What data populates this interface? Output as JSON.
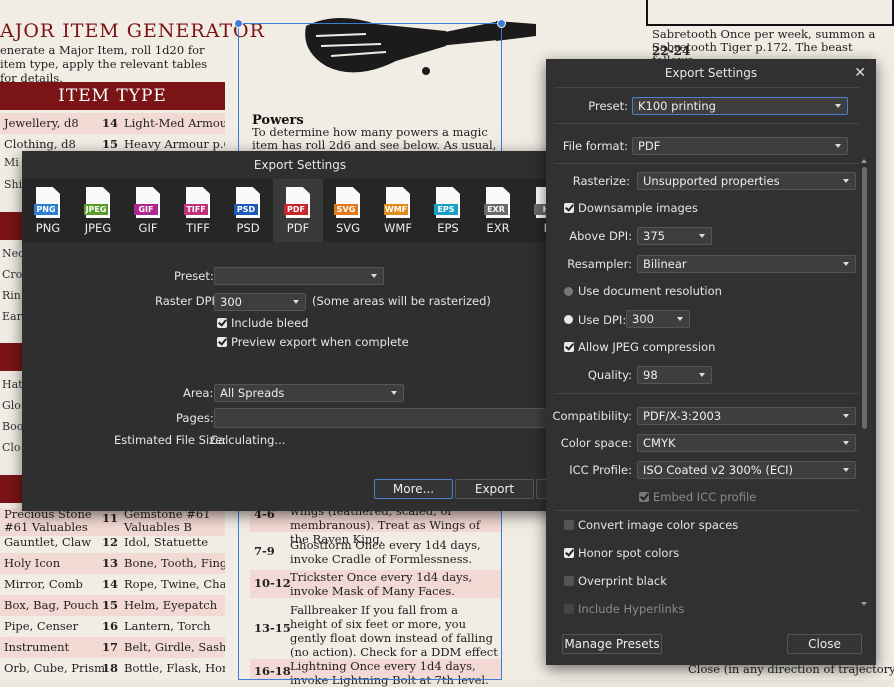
{
  "document": {
    "title": "AJOR ITEM GENERATOR",
    "intro": "enerate a Major Item, roll 1d20 for item type, apply the relevant tables for details.",
    "banner": "ITEM TYPE",
    "item_rows_top": [
      {
        "a": "Jewellery, d8",
        "n": "14",
        "b": "Light-Med Armour p.61"
      },
      {
        "a": "Clothing, d8",
        "n": "15",
        "b": "Heavy Armour p.61"
      }
    ],
    "left_fragments": [
      "Mi",
      "Shi",
      "Nec",
      "Cro",
      "Rin",
      "Ear",
      "Hat",
      "Glo",
      "Boo",
      "Clo"
    ],
    "item_rows_bottom": [
      {
        "a": "Precious Stone #61 Valuables A",
        "n": "11",
        "b": "Gemstone #61 Valuables B"
      },
      {
        "a": "Gauntlet, Claw",
        "n": "12",
        "b": "Idol, Statuette"
      },
      {
        "a": "Holy Icon",
        "n": "13",
        "b": "Bone, Tooth, Finger"
      },
      {
        "a": "Mirror, Comb",
        "n": "14",
        "b": "Rope, Twine, Chain"
      },
      {
        "a": "Box, Bag, Pouch",
        "n": "15",
        "b": "Helm, Eyepatch"
      },
      {
        "a": "Pipe, Censer",
        "n": "16",
        "b": "Lantern, Torch"
      },
      {
        "a": "Instrument",
        "n": "17",
        "b": "Belt, Girdle, Sash"
      },
      {
        "a": "Orb, Cube, Prism",
        "n": "18",
        "b": "Bottle, Flask, Horn"
      }
    ],
    "powers_heading": "Powers",
    "powers_text": "To determine how many powers a magic item has roll 2d6 and see below. As usual, the owner must",
    "powers_rows": [
      {
        "n": "4-6",
        "t": "wings (feathered, scaled, or membranous). Treat as Wings of the Raven King."
      },
      {
        "n": "7-9",
        "t": "Ghostform Once every 1d4 days, invoke Cradle of Formlessness."
      },
      {
        "n": "10-12",
        "t": "Trickster Once every 1d4 days, invoke Mask of Many Faces."
      },
      {
        "n": "13-15",
        "t": "Fallbreaker If you fall from a height of six feet or more, you gently float down instead of falling (no action). Check for a DDM effect each time this activates."
      },
      {
        "n": "16-18",
        "t": "Lightning Once every 1d4 days, invoke Lightning Bolt at 7th level."
      }
    ],
    "right_text": "Sabretooth Once per week, summon a Sabretooth Tiger p.172. The beast follows",
    "right_num": "22-24",
    "right_bottom": "Close (in any direction of trajectory)."
  },
  "export_left": {
    "title": "Export Settings",
    "formats": [
      {
        "name": "PNG",
        "color": "#2f7fd1"
      },
      {
        "name": "JPEG",
        "color": "#5a9a2a"
      },
      {
        "name": "GIF",
        "color": "#b0278f"
      },
      {
        "name": "TIFF",
        "color": "#c0337a"
      },
      {
        "name": "PSD",
        "color": "#1f5bb8"
      },
      {
        "name": "PDF",
        "color": "#c8262a"
      },
      {
        "name": "SVG",
        "color": "#e07a1a"
      },
      {
        "name": "WMF",
        "color": "#e08a1a"
      },
      {
        "name": "EPS",
        "color": "#1aa0c8"
      },
      {
        "name": "EXR",
        "color": "#6a6a6a"
      },
      {
        "name": "H",
        "color": "#6a6a6a"
      }
    ],
    "selected_format": "PDF",
    "preset_label": "Preset:",
    "preset_value": "",
    "raster_dpi_label": "Raster DPI:",
    "raster_dpi_value": "300",
    "raster_note": "(Some areas will be rasterized)",
    "include_bleed": "Include bleed",
    "preview_export": "Preview export when complete",
    "area_label": "Area:",
    "area_value": "All Spreads",
    "pages_label": "Pages:",
    "pages_value": "",
    "file_size_label": "Estimated File Size:",
    "file_size_value": "Calculating...",
    "more_button": "More...",
    "export_button": "Export"
  },
  "export_right": {
    "title": "Export Settings",
    "close_glyph": "✕",
    "preset_label": "Preset:",
    "preset_value": "K100 printing",
    "file_format_label": "File format:",
    "file_format_value": "PDF",
    "rasterize_label": "Rasterize:",
    "rasterize_value": "Unsupported properties",
    "downsample": "Downsample images",
    "above_dpi_label": "Above DPI:",
    "above_dpi_value": "375",
    "resampler_label": "Resampler:",
    "resampler_value": "Bilinear",
    "use_doc_res": "Use document resolution",
    "use_dpi": "Use DPI:",
    "use_dpi_value": "300",
    "allow_jpeg": "Allow JPEG compression",
    "quality_label": "Quality:",
    "quality_value": "98",
    "compat_label": "Compatibility:",
    "compat_value": "PDF/X-3:2003",
    "colorspace_label": "Color space:",
    "colorspace_value": "CMYK",
    "icc_label": "ICC Profile:",
    "icc_value": "ISO Coated v2 300% (ECI)",
    "embed_icc": "Embed ICC profile",
    "convert_spaces": "Convert image color spaces",
    "honor_spot": "Honor spot colors",
    "overprint": "Overprint black",
    "hyperlinks": "Include Hyperlinks",
    "manage_presets": "Manage Presets",
    "close_button": "Close"
  }
}
